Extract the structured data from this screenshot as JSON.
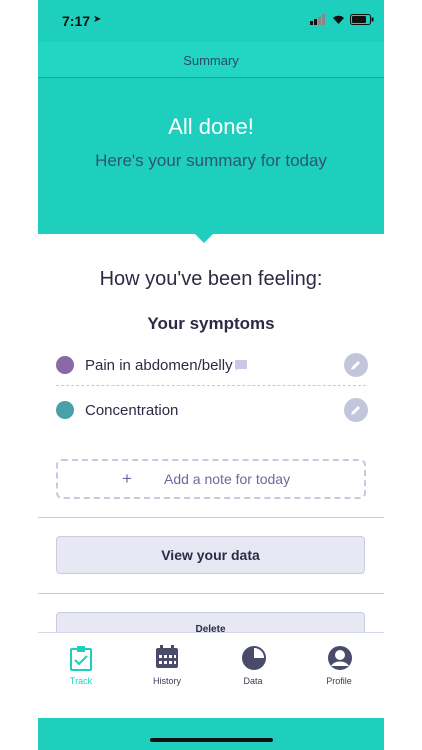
{
  "status": {
    "time": "7:17"
  },
  "header": {
    "title": "Summary"
  },
  "hero": {
    "title": "All done!",
    "subtitle": "Here's your summary for today"
  },
  "content": {
    "feeling_heading": "How you've been feeling:",
    "symptoms_heading": "Your symptoms",
    "symptoms": [
      {
        "label": "Pain in abdomen/belly",
        "color": "#8a69a8",
        "has_comment": true
      },
      {
        "label": "Concentration",
        "color": "#4aa0a9",
        "has_comment": false
      }
    ],
    "note": {
      "plus": "+",
      "label": "Add a note for today"
    },
    "view_data_label": "View your data",
    "delete_label": "Delete"
  },
  "tabs": [
    {
      "label": "Track",
      "icon": "clipboard-check-icon",
      "active": true
    },
    {
      "label": "History",
      "icon": "calendar-icon",
      "active": false
    },
    {
      "label": "Data",
      "icon": "pie-chart-icon",
      "active": false
    },
    {
      "label": "Profile",
      "icon": "user-avatar-icon",
      "active": false
    }
  ],
  "colors": {
    "accent": "#1ecfbd",
    "text": "#2b2b45",
    "icon_dark": "#4a4a6a"
  }
}
